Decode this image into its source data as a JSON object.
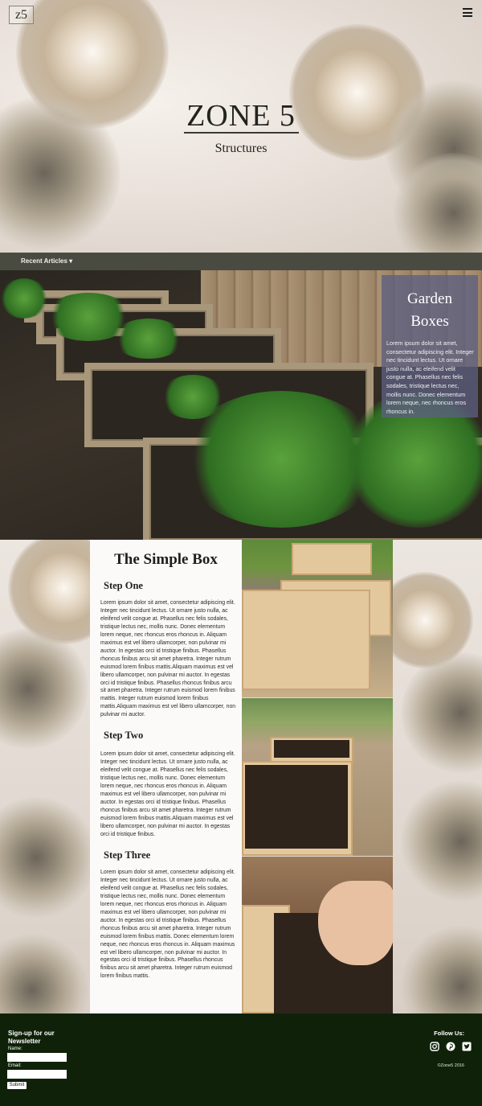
{
  "header": {
    "logo_text": "z5",
    "menu_icon": "hamburger-menu-icon",
    "title": "ZONE 5",
    "subtitle": "Structures"
  },
  "nav": {
    "recent_articles": "Recent Articles ▾"
  },
  "featured": {
    "title_line1": "Garden",
    "title_line2": "Boxes",
    "body": "Lorem ipsum dolor sit amet, consectetur adipiscing elit. Integer nec tincidunt lectus. Ut ornare justo nulla, ac eleifend velit congue at. Phasellus nec felis sodales, tristique lectus nec, mollis nunc. Donec elementum lorem neque, nec rhoncus eros rhoncus in."
  },
  "article": {
    "title": "The Simple Box",
    "steps": [
      {
        "title": "Step One",
        "body": "Lorem ipsum dolor sit amet, consectetur adipiscing elit. Integer nec tincidunt lectus. Ut ornare justo nulla, ac eleifend velit congue at. Phasellus nec felis sodales, tristique lectus nec, mollis nunc. Donec elementum lorem neque, nec rhoncus eros rhoncus in. Aliquam maximus est vel libero ullamcorper, non pulvinar mi auctor. In egestas orci id tristique finibus. Phasellus rhoncus finibus arcu sit amet pharetra. Integer rutrum euismod lorem finibus mattis.Aliquam maximus est vel libero ullamcorper, non pulvinar mi auctor. In egestas orci id tristique finibus. Phasellus rhoncus finibus arcu sit amet pharetra. Integer rutrum euismod lorem finibus mattis. Integer rutrum euismod lorem finibus mattis.Aliquam maximus est vel libero ullamcorper, non pulvinar mi auctor."
      },
      {
        "title": "Step Two",
        "body": "Lorem ipsum dolor sit amet, consectetur adipiscing elit. Integer nec tincidunt lectus. Ut ornare justo nulla, ac eleifend velit congue at. Phasellus nec felis sodales, tristique lectus nec, mollis nunc. Donec elementum lorem neque, nec rhoncus eros rhoncus in. Aliquam maximus est vel libero ullamcorper, non pulvinar mi auctor. In egestas orci id tristique finibus. Phasellus rhoncus finibus arcu sit amet pharetra. Integer rutrum euismod lorem finibus mattis.Aliquam maximus est vel libero ullamcorper, non pulvinar mi auctor. In egestas orci id tristique finibus."
      },
      {
        "title": "Step Three",
        "body": "Lorem ipsum dolor sit amet, consectetur adipiscing elit. Integer nec tincidunt lectus. Ut ornare justo nulla, ac eleifend velit congue at. Phasellus nec felis sodales, tristique lectus nec, mollis nunc. Donec elementum lorem neque, nec rhoncus eros rhoncus in. Aliquam maximus est vel libero ullamcorper, non pulvinar mi auctor. In egestas orci id tristique finibus. Phasellus rhoncus finibus arcu sit amet pharetra. Integer rutrum euismod lorem finibus mattis. Donec elementum lorem neque, nec rhoncus eros rhoncus in. Aliquam maximus est vel libero ullamcorper, non pulvinar mi auctor. In egestas orci id tristique finibus. Phasellus rhoncus finibus arcu sit amet pharetra. Integer rutrum euismod lorem finibus mattis."
      }
    ]
  },
  "footer": {
    "newsletter_title": "Sign-up for our Newsletter",
    "name_label": "Name:",
    "email_label": "Email:",
    "submit_label": "Submit",
    "follow_label": "Follow Us:",
    "social_icons": [
      "instagram-icon",
      "pinterest-icon",
      "twitter-icon"
    ],
    "copyright": "©Zone5 2016"
  },
  "colors": {
    "navbar": "#4a4b40",
    "card_overlay": "#5c5f80",
    "footer": "#0f2209"
  }
}
